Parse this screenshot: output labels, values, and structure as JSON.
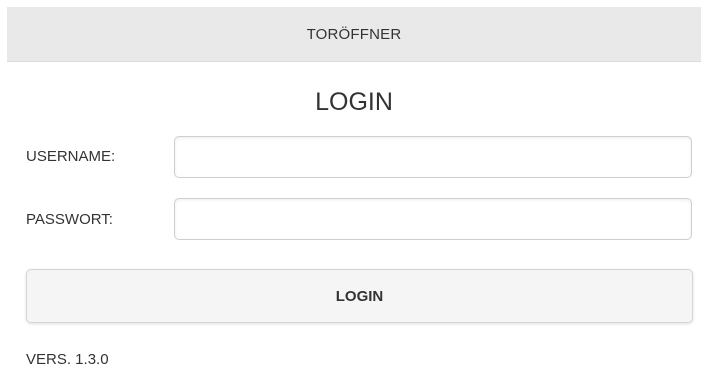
{
  "header": {
    "title": "TORÖFFNER"
  },
  "login": {
    "title": "LOGIN",
    "username_label": "USERNAME:",
    "username_value": "",
    "password_label": "PASSWORT:",
    "password_value": "",
    "button_label": "LOGIN"
  },
  "footer": {
    "version": "VERS. 1.3.0"
  },
  "colors": {
    "header_background": "#e9e9e9",
    "button_background": "#f5f5f5",
    "text": "#333333",
    "input_border": "#cfcfcf"
  }
}
